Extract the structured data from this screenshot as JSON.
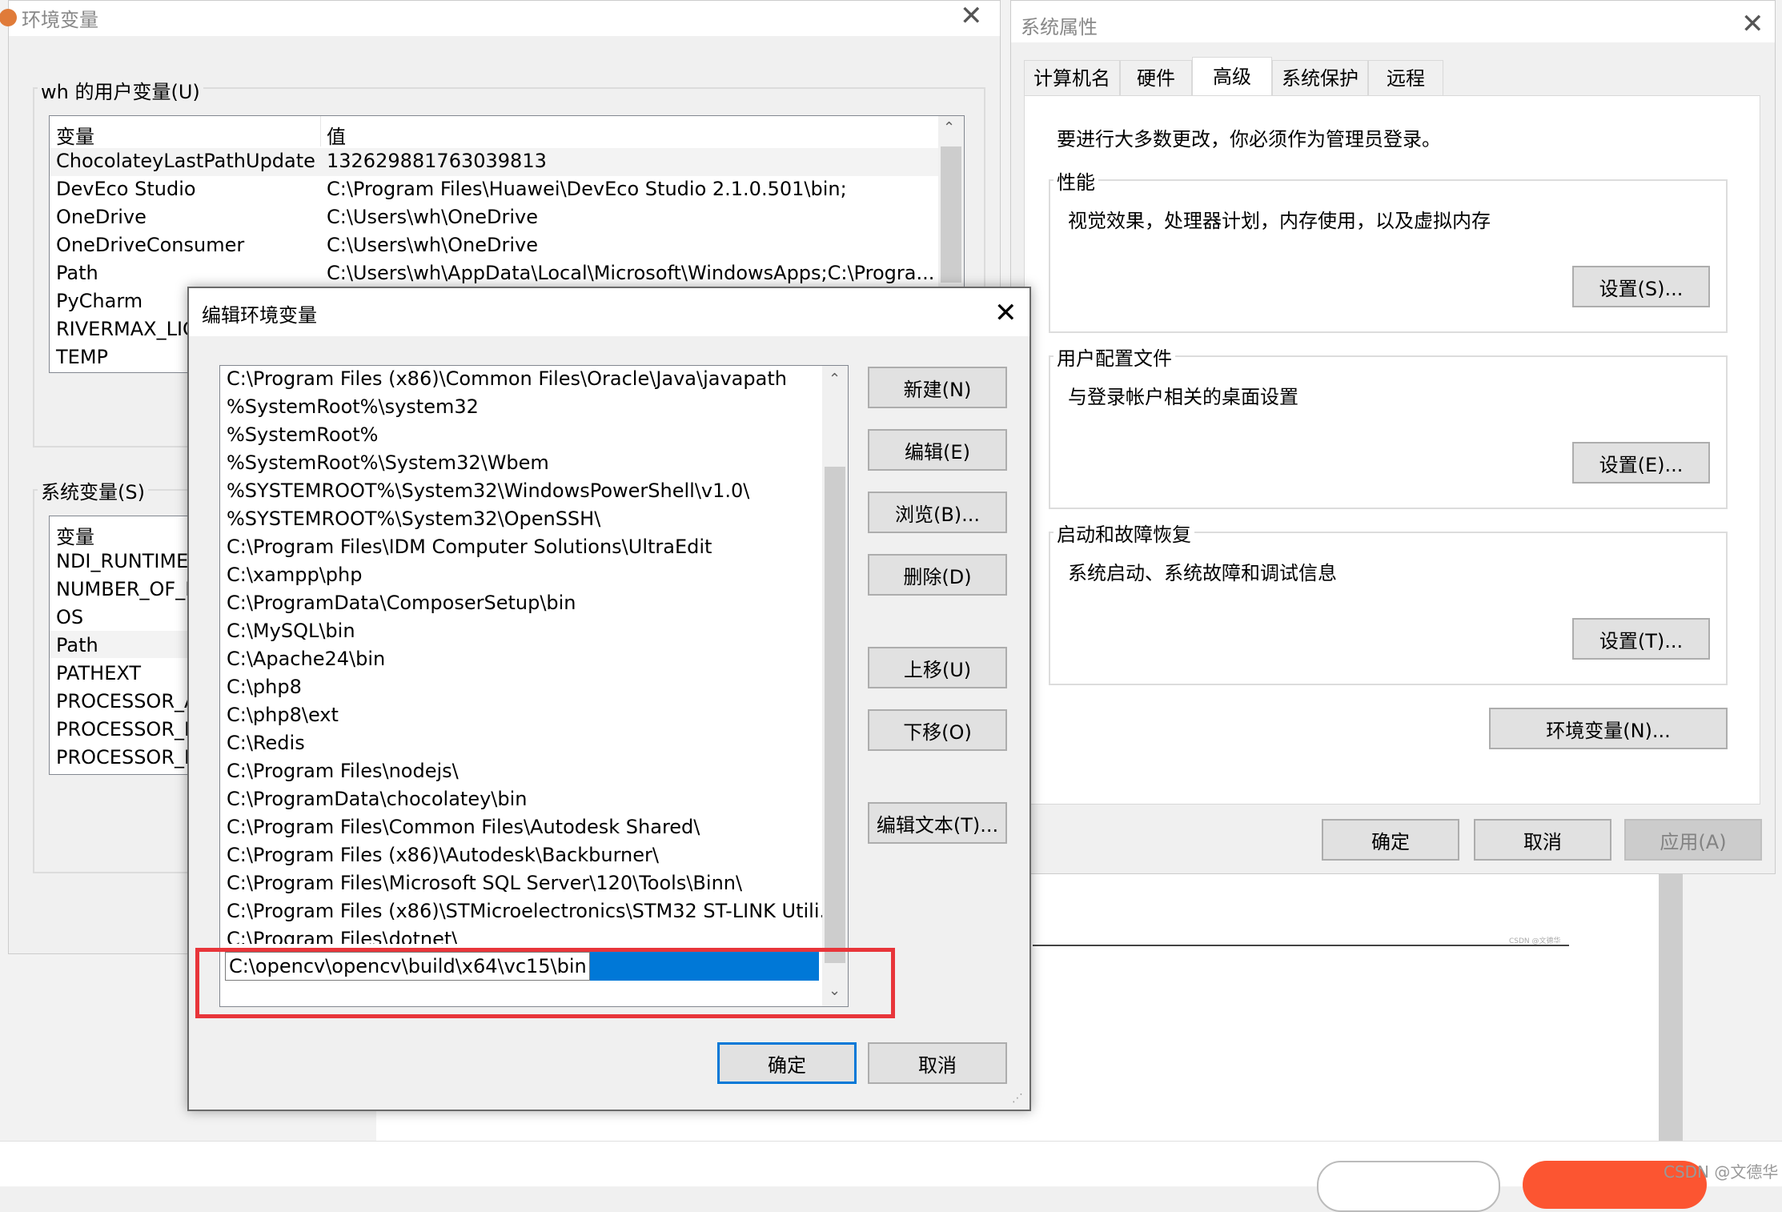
{
  "env_window": {
    "title": "环境变量",
    "user_vars_label": "wh 的用户变量(U)",
    "col_var": "变量",
    "col_val": "值",
    "user_vars": [
      {
        "name": "ChocolateyLastPathUpdate",
        "value": "132629881763039813"
      },
      {
        "name": "DevEco Studio",
        "value": "C:\\Program Files\\Huawei\\DevEco Studio 2.1.0.501\\bin;"
      },
      {
        "name": "OneDrive",
        "value": "C:\\Users\\wh\\OneDrive"
      },
      {
        "name": "OneDriveConsumer",
        "value": "C:\\Users\\wh\\OneDrive"
      },
      {
        "name": "Path",
        "value": "C:\\Users\\wh\\AppData\\Local\\Microsoft\\WindowsApps;C:\\Progra..."
      },
      {
        "name": "PyCharm",
        "value": ""
      },
      {
        "name": "RIVERMAX_LIC",
        "value": ""
      },
      {
        "name": "TEMP",
        "value": ""
      }
    ],
    "sys_vars_label": "系统变量(S)",
    "sys_col_var": "变量",
    "sys_vars": [
      "NDI_RUNTIME",
      "NUMBER_OF_P",
      "OS",
      "Path",
      "PATHEXT",
      "PROCESSOR_A",
      "PROCESSOR_ID",
      "PROCESSOR_L"
    ]
  },
  "edit_dialog": {
    "title": "编辑环境变量",
    "paths": [
      "C:\\Program Files (x86)\\Common Files\\Oracle\\Java\\javapath",
      "%SystemRoot%\\system32",
      "%SystemRoot%",
      "%SystemRoot%\\System32\\Wbem",
      "%SYSTEMROOT%\\System32\\WindowsPowerShell\\v1.0\\",
      "%SYSTEMROOT%\\System32\\OpenSSH\\",
      "C:\\Program Files\\IDM Computer Solutions\\UltraEdit",
      "C:\\xampp\\php",
      "C:\\ProgramData\\ComposerSetup\\bin",
      "C:\\MySQL\\bin",
      "C:\\Apache24\\bin",
      "C:\\php8",
      "C:\\php8\\ext",
      "C:\\Redis",
      "C:\\Program Files\\nodejs\\",
      "C:\\ProgramData\\chocolatey\\bin",
      "C:\\Program Files\\Common Files\\Autodesk Shared\\",
      "C:\\Program Files (x86)\\Autodesk\\Backburner\\",
      "C:\\Program Files\\Microsoft SQL Server\\120\\Tools\\Binn\\",
      "C:\\Program Files (x86)\\STMicroelectronics\\STM32 ST-LINK Utili...",
      "C:\\Program Files\\dotnet\\"
    ],
    "editing_value": "C:\\opencv\\opencv\\build\\x64\\vc15\\bin",
    "buttons": {
      "new": "新建(N)",
      "edit": "编辑(E)",
      "browse": "浏览(B)...",
      "delete": "删除(D)",
      "move_up": "上移(U)",
      "move_down": "下移(O)",
      "edit_text": "编辑文本(T)...",
      "ok": "确定",
      "cancel": "取消"
    },
    "highlight_color": "#e8353a",
    "selection_color": "#0078d7"
  },
  "sys_props": {
    "title": "系统属性",
    "tabs": [
      "计算机名",
      "硬件",
      "高级",
      "系统保护",
      "远程"
    ],
    "active_tab": "高级",
    "admin_note": "要进行大多数更改，你必须作为管理员登录。",
    "perf_label": "性能",
    "perf_desc": "视觉效果，处理器计划，内存使用，以及虚拟内存",
    "perf_btn": "设置(S)...",
    "profile_label": "用户配置文件",
    "profile_desc": "与登录帐户相关的桌面设置",
    "profile_btn": "设置(E)...",
    "startup_label": "启动和故障恢复",
    "startup_desc": "系统启动、系统故障和调试信息",
    "startup_btn": "设置(T)...",
    "env_btn": "环境变量(N)...",
    "ok": "确定",
    "cancel": "取消",
    "apply": "应用(A)"
  },
  "background": {
    "watermark_small": "CSDN @文德华",
    "watermark": "CSDN @文德华"
  }
}
